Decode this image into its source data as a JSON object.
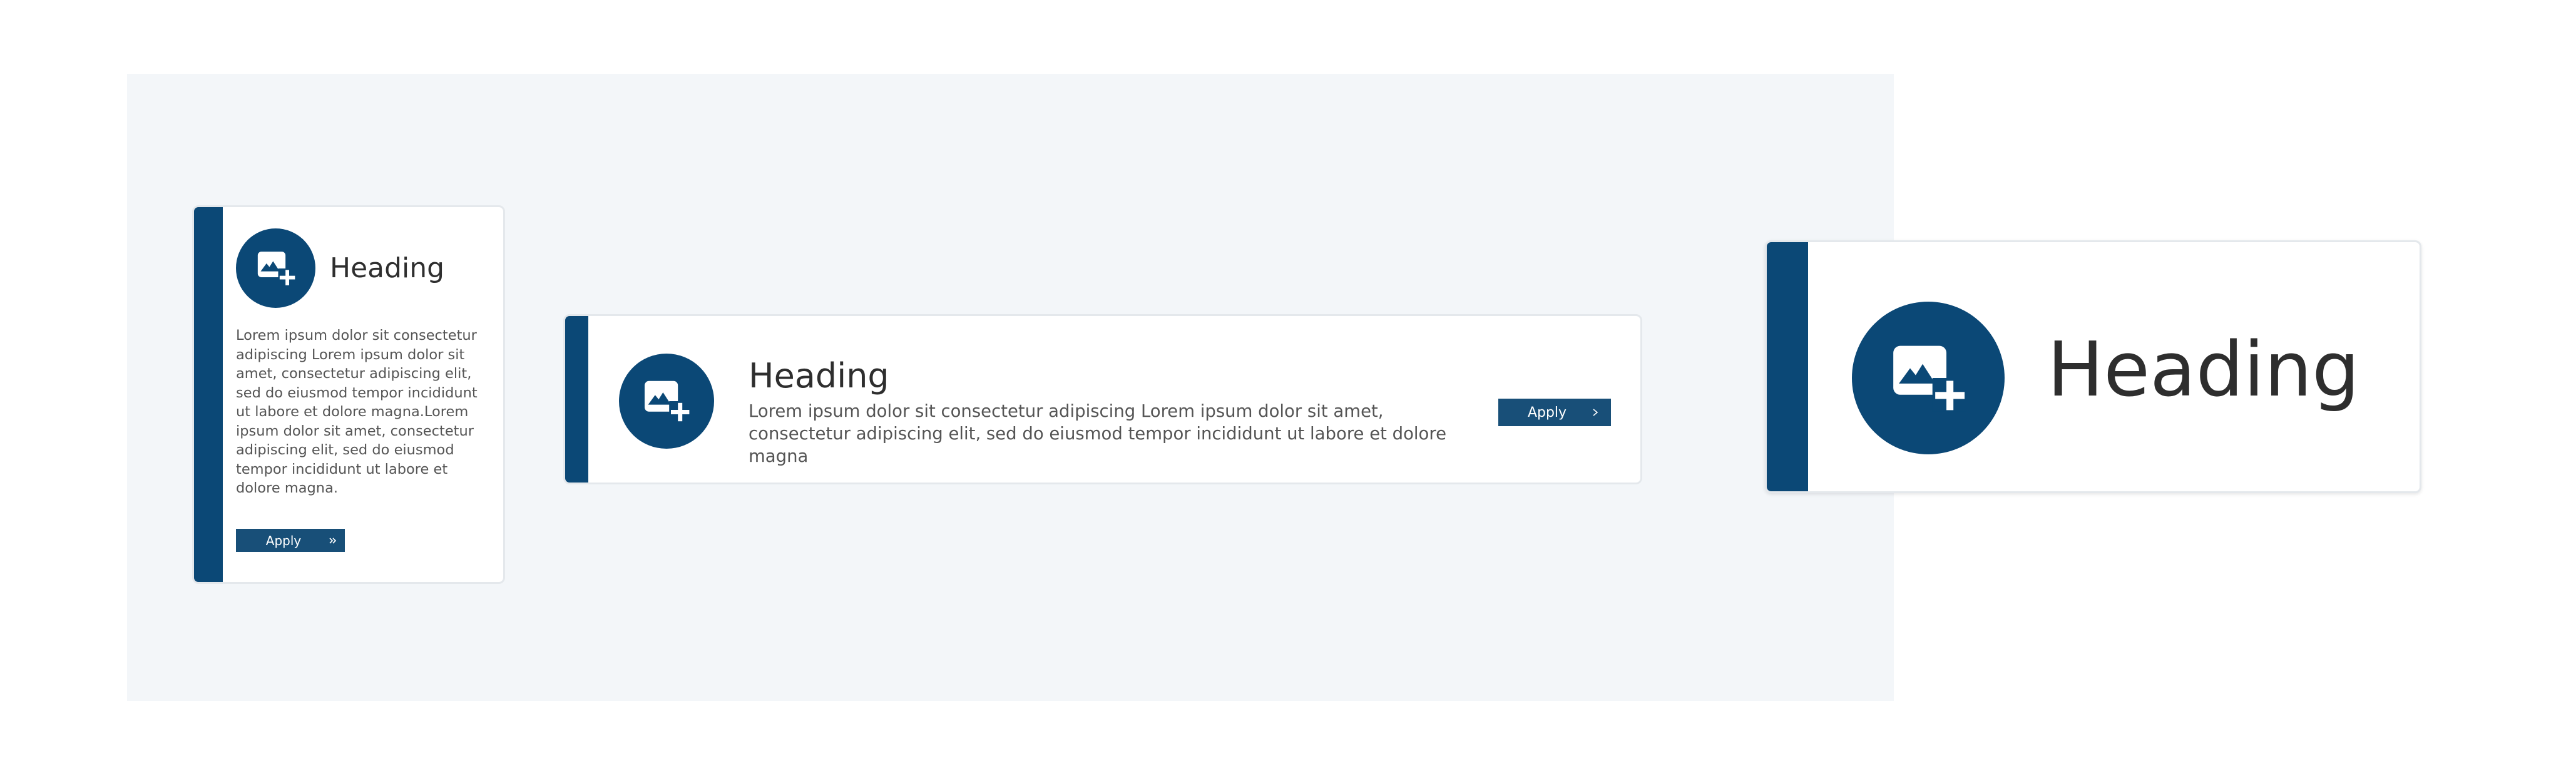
{
  "colors": {
    "accent": "#0b4876",
    "button": "#184f78",
    "panel_background": "#f3f6f9",
    "heading_text": "#2e2e2e",
    "body_text": "#555555"
  },
  "cards": {
    "vertical": {
      "icon": "image-add-icon",
      "heading": "Heading",
      "body": "Lorem ipsum dolor sit consectetur adipiscing Lorem ipsum dolor sit amet, consectetur adipiscing elit, sed do eiusmod tempor incididunt ut labore et dolore magna.Lorem ipsum dolor sit amet, consectetur adipiscing elit, sed do eiusmod tempor incididunt ut labore et dolore magna.",
      "button_label": "Apply",
      "button_icon": "double-chevron-right-icon"
    },
    "horizontal": {
      "icon": "image-add-icon",
      "heading": "Heading",
      "body": "Lorem ipsum dolor sit consectetur adipiscing Lorem ipsum dolor sit amet, consectetur adipiscing elit, sed do eiusmod tempor incididunt ut labore et dolore magna",
      "button_label": "Apply",
      "button_icon": "chevron-right-icon"
    },
    "large": {
      "icon": "image-add-icon",
      "heading": "Heading"
    }
  }
}
